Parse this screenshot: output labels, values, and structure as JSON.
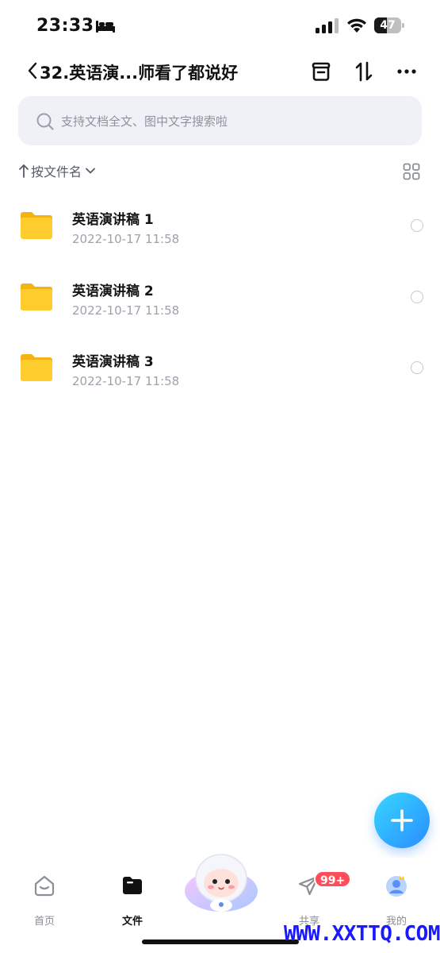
{
  "status_bar": {
    "time": "23:33",
    "battery": "47",
    "battery_level": 0.47,
    "icons": [
      "sleep-icon",
      "cellular-signal-icon",
      "wifi-icon",
      "battery-icon"
    ]
  },
  "header": {
    "title": "32.英语演...师看了都说好",
    "icons": [
      "back-icon",
      "bag-icon",
      "sort-swap-icon",
      "more-icon"
    ]
  },
  "search": {
    "placeholder": "支持文档全文、图中文字搜索啦",
    "icon": "search-icon"
  },
  "sort": {
    "label": "按文件名",
    "icons": [
      "sort-up-arrow-icon",
      "chevron-down-icon",
      "grid-view-icon"
    ]
  },
  "files": [
    {
      "name": "英语演讲稿 1",
      "date": "2022-10-17 11:58",
      "icon": "folder-icon"
    },
    {
      "name": "英语演讲稿 2",
      "date": "2022-10-17 11:58",
      "icon": "folder-icon"
    },
    {
      "name": "英语演讲稿 3",
      "date": "2022-10-17 11:58",
      "icon": "folder-icon"
    }
  ],
  "fab": {
    "icon": "plus-icon"
  },
  "tabs": [
    {
      "label": "首页",
      "icon": "home-icon",
      "active": false
    },
    {
      "label": "文件",
      "icon": "folder-icon",
      "active": true
    },
    {
      "label": "共享",
      "icon": "share-plane-icon",
      "active": false,
      "badge": "99+"
    },
    {
      "label": "我的",
      "icon": "profile-avatar-icon",
      "active": false
    }
  ],
  "watermark": "WWW.XXTTQ.COM",
  "colors": {
    "accent": "#2a8cff",
    "folder": "#ffc928",
    "badge": "#ff4d5a",
    "watermark": "#1a1aff"
  }
}
